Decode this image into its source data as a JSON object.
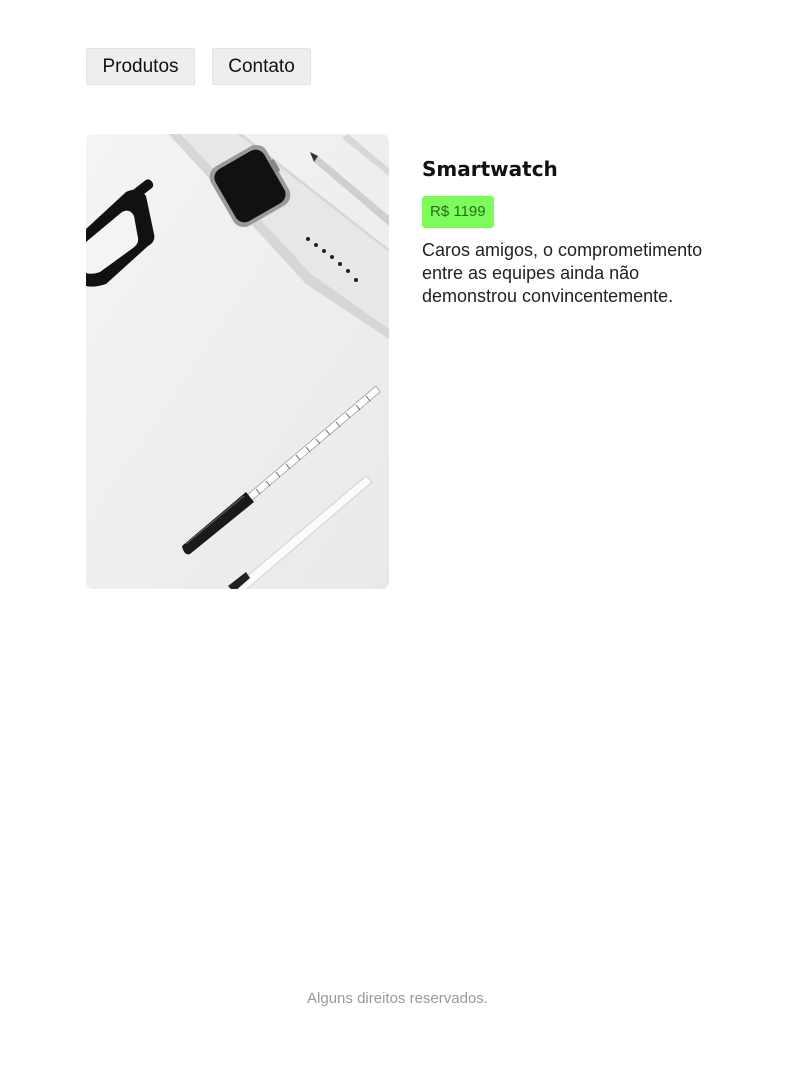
{
  "nav": {
    "items": [
      {
        "label": "Produtos"
      },
      {
        "label": "Contato"
      }
    ]
  },
  "product": {
    "title": "Smartwatch",
    "price": "R$ 1199",
    "description": "Caros amigos, o comprometimento entre as equipes ainda não demonstrou convincentemente.",
    "price_badge_color": "#7cfc5a"
  },
  "footer": {
    "text": "Alguns direitos reservados."
  }
}
